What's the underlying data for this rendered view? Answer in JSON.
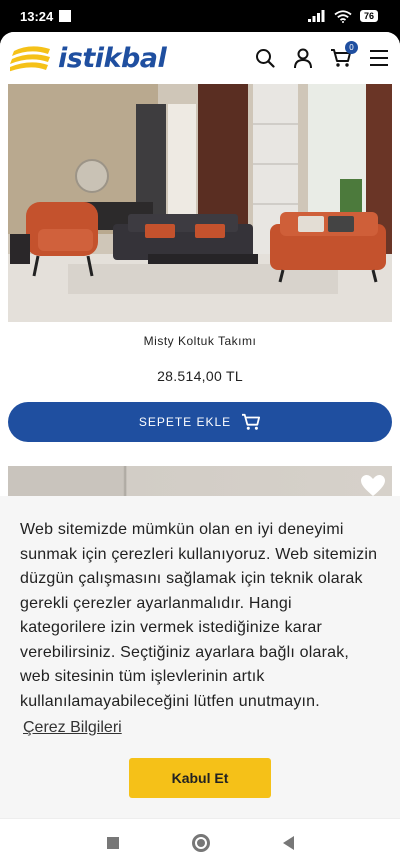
{
  "status_bar": {
    "time": "13:24",
    "battery": "76"
  },
  "header": {
    "logo_text": "istikbal",
    "cart_count": "0",
    "icons": [
      "search-icon",
      "user-icon",
      "cart-icon",
      "menu-icon"
    ]
  },
  "product": {
    "name": "Misty Koltuk Takımı",
    "price": "28.514,00 TL",
    "add_to_cart_label": "SEPETE EKLE"
  },
  "cookie_banner": {
    "text": "Web sitemizde mümkün olan en iyi deneyimi sunmak için çerezleri kullanıyoruz. Web sitemizin düzgün çalışmasını sağlamak için teknik olarak gerekli çerezler ayarlanmalıdır. Hangi kategorilere izin vermek istediğinize karar verebilirsiniz. Seçtiğiniz ayarlara bağlı olarak, web sitesinin tüm işlevlerinin artık kullanılamayabileceğini lütfen unutmayın.",
    "link_label": "Çerez Bilgileri",
    "accept_label": "Kabul Et"
  },
  "colors": {
    "brand_blue": "#1f4fa0",
    "brand_yellow": "#f5c118",
    "sofa_orange": "#c4522d"
  }
}
